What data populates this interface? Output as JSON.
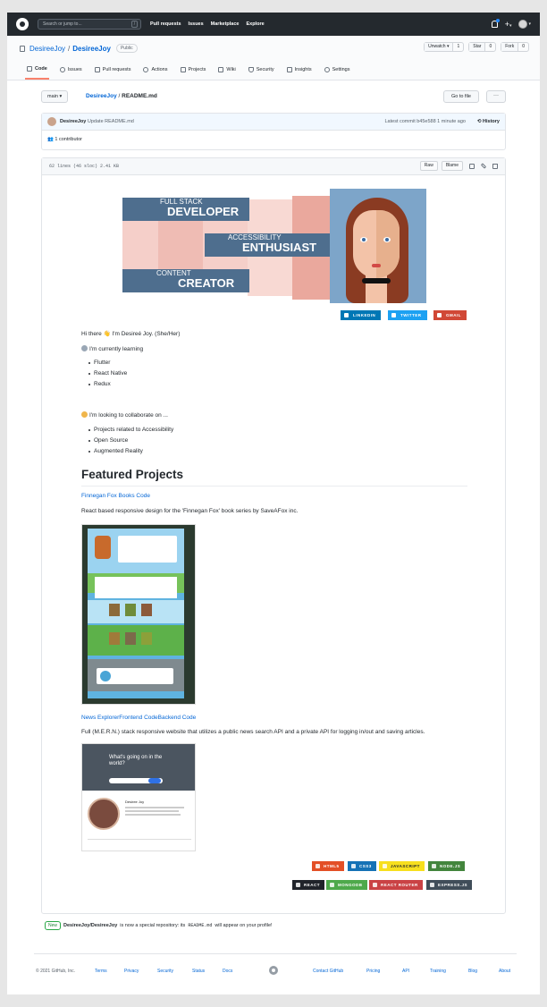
{
  "topnav": {
    "search_placeholder": "Search or jump to...",
    "search_key": "/",
    "links": [
      "Pull requests",
      "Issues",
      "Marketplace",
      "Explore"
    ],
    "plus": "+",
    "caret": "▾"
  },
  "repo": {
    "owner": "DesireeJoy",
    "name": "DesireeJoy",
    "separator": "/",
    "visibility": "Public",
    "unwatch_label": "Unwatch ▾",
    "unwatch_count": "1",
    "star_label": "Star",
    "star_count": "0",
    "fork_label": "Fork",
    "fork_count": "0"
  },
  "tabs": [
    "Code",
    "Issues",
    "Pull requests",
    "Actions",
    "Projects",
    "Wiki",
    "Security",
    "Insights",
    "Settings"
  ],
  "crumbs": {
    "branch": "main ▾",
    "owner_link": "DesireeJoy",
    "sep": "/",
    "file": "README.md",
    "goto_label": "Go to file",
    "more_label": "···"
  },
  "commit": {
    "author": "DesireeJoy",
    "message": "Update README.md",
    "latest": "Latest commit b45e588 1 minute ago",
    "history": "History",
    "contributors": "1 contributor"
  },
  "file": {
    "meta": "62 lines (46 sloc)   2.41 KB",
    "raw_label": "Raw",
    "blame_label": "Blame"
  },
  "banner": {
    "fullstack_top": "FULL STACK",
    "fullstack_bottom": "DEVELOPER",
    "access_top": "ACCESSIBILITY",
    "access_bottom": "ENTHUSIAST",
    "content_top": "CONTENT",
    "content_bottom": "CREATOR"
  },
  "social": [
    {
      "label": "LINKEDIN",
      "color": "#0077b5"
    },
    {
      "label": "TWITTER",
      "color": "#1da1f2"
    },
    {
      "label": "GMAIL",
      "color": "#d14836"
    }
  ],
  "readme": {
    "greeting": "Hi there 👋 I'm Desireé Joy. (She/Her)",
    "learning": "I'm currently learning",
    "learning_items": [
      "Flutter",
      "React Native",
      "Redux"
    ],
    "collab": "I'm looking to collaborate on ...",
    "collab_items": [
      "Projects related to Accessibility",
      "Open Source",
      "Augmented Reality"
    ],
    "featured_heading": "Featured Projects",
    "project1_link": "Finnegan Fox Books Code",
    "project1_desc": "React based responsive design for the 'Finnegan Fox' book series by SaveAFox inc.",
    "project2_links": [
      "News Explorer",
      "Frontend Code",
      "Backend Code"
    ],
    "project2_desc": "Full (M.E.R.N.) stack responsive website that utilizes a public news search API and a private API for logging in/out and saving articles.",
    "shot2_headline": "What's going on in the world?",
    "shot2_name": "Desiree Joy"
  },
  "tech_badges_row1": [
    {
      "label": "HTML5",
      "color": "#e34f26"
    },
    {
      "label": "CSS3",
      "color": "#1572b6"
    },
    {
      "label": "JAVASCRIPT",
      "color": "#f7df1e",
      "text": "#24292e"
    },
    {
      "label": "NODE.JS",
      "color": "#43853d"
    }
  ],
  "tech_badges_row2": [
    {
      "label": "REACT",
      "color": "#20232a"
    },
    {
      "label": "MONGODB",
      "color": "#4ea94b"
    },
    {
      "label": "REACT ROUTER",
      "color": "#ca4245"
    },
    {
      "label": "EXPRESS.JS",
      "color": "#404d59"
    }
  ],
  "special": {
    "new_label": "New",
    "repo": "DesireeJoy/DesireeJoy",
    "text_before": "is now a special repository: its",
    "code": "README.md",
    "text_after": "will appear on your profile!"
  },
  "footer": {
    "copyright": "© 2021 GitHub, Inc.",
    "links_left": [
      "Terms",
      "Privacy",
      "Security",
      "Status",
      "Docs"
    ],
    "links_right": [
      "Contact GitHub",
      "Pricing",
      "API",
      "Training",
      "Blog",
      "About"
    ]
  }
}
